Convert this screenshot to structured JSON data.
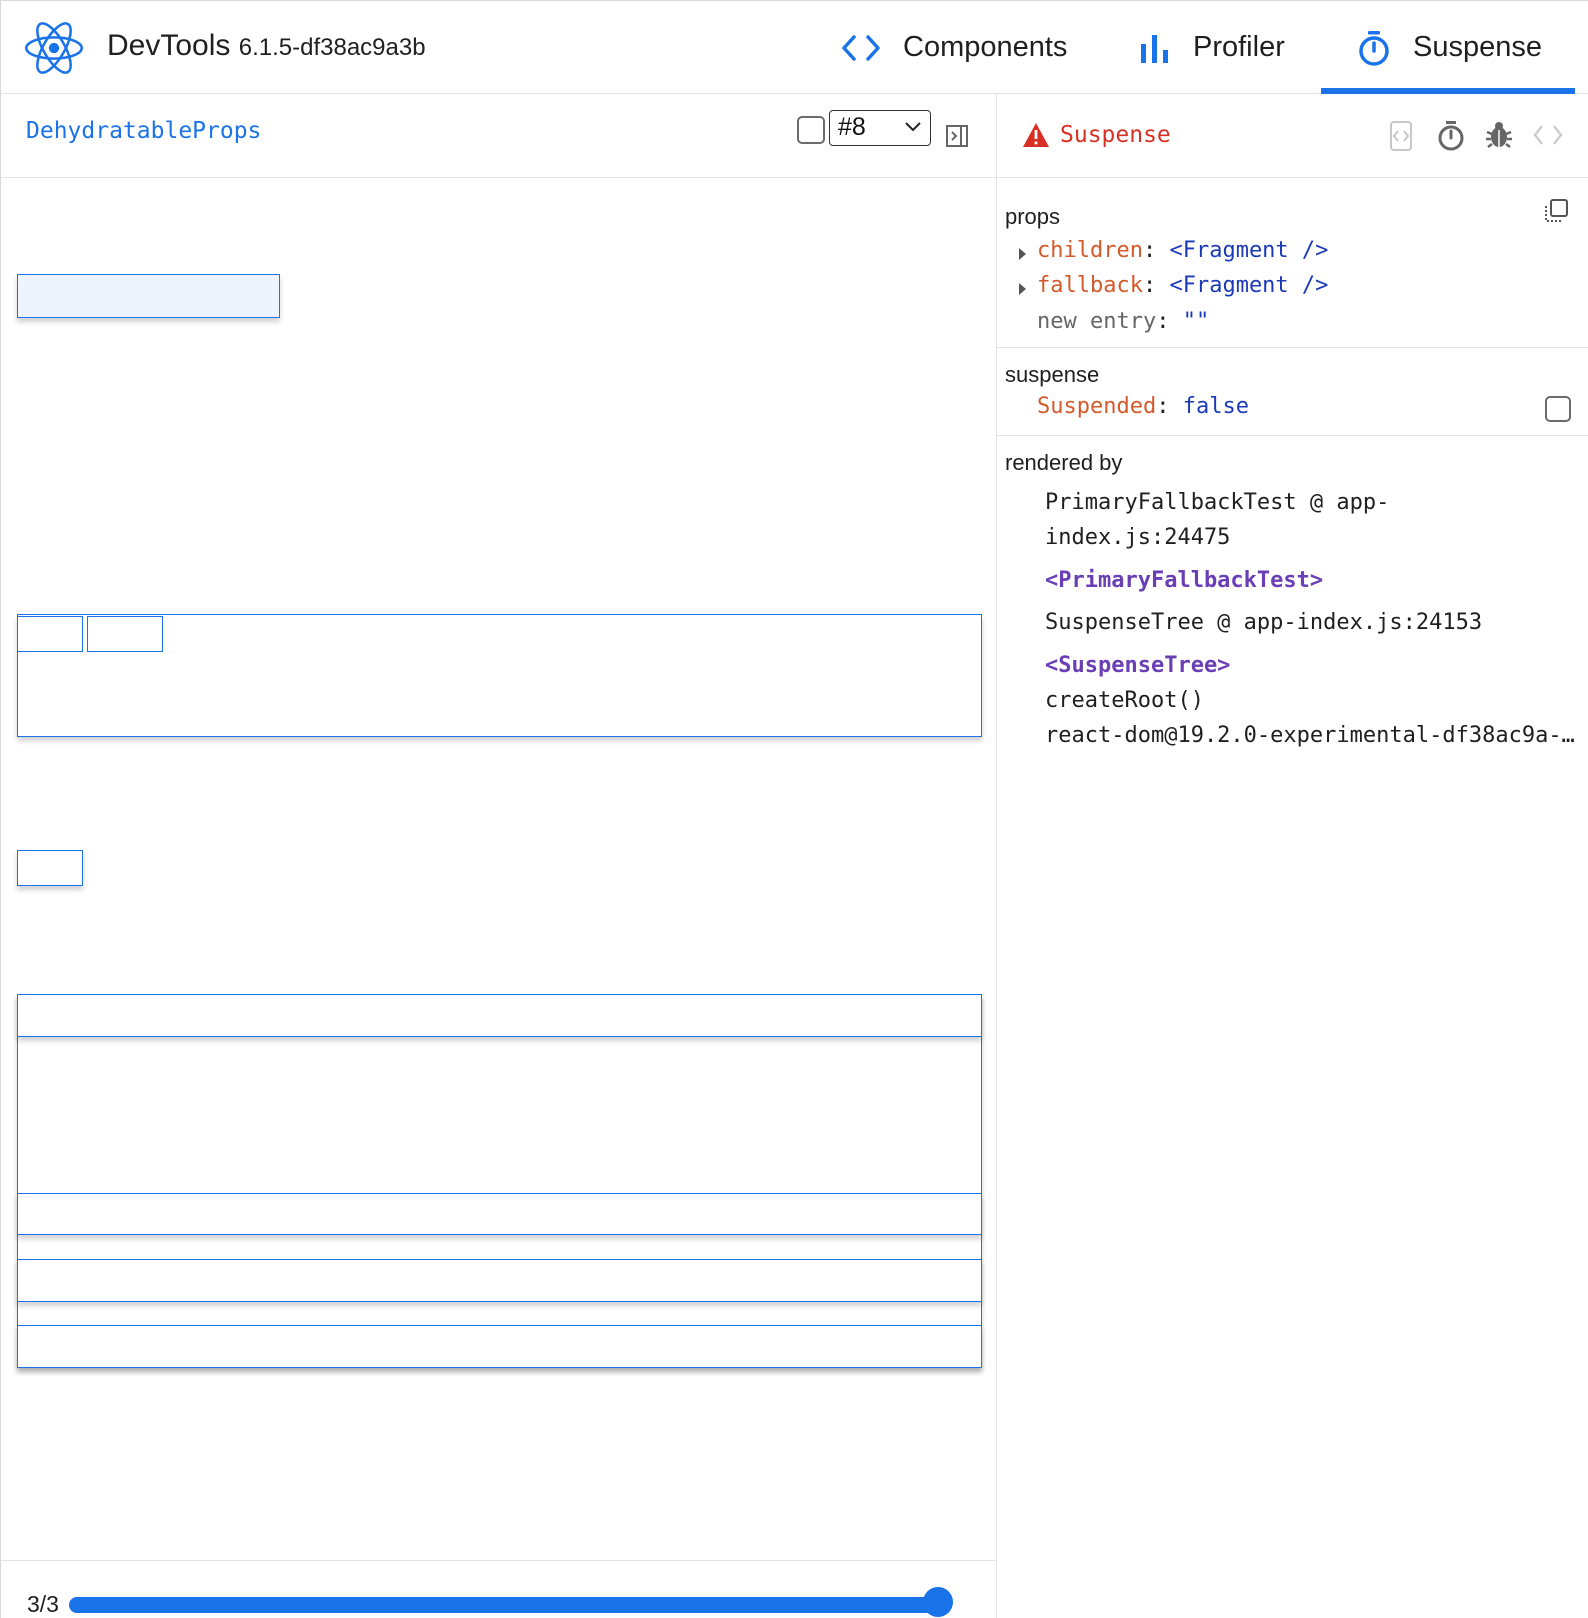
{
  "header": {
    "app_title": "DevTools",
    "app_version": "6.1.5-df38ac9a3b",
    "tabs": [
      {
        "label": "Components",
        "icon": "code-brackets-icon"
      },
      {
        "label": "Profiler",
        "icon": "bar-chart-icon"
      },
      {
        "label": "Suspense",
        "icon": "stopwatch-icon",
        "active": true
      }
    ],
    "accent_color": "#1a73e8"
  },
  "left_pane": {
    "breadcrumb": "DehydratableProps",
    "root_select": {
      "value": "#8"
    },
    "timeline": {
      "label": "3/3",
      "progress": 1.0
    }
  },
  "right_pane": {
    "selected_name": "Suspense",
    "selected_icon": "warning-icon",
    "toolbar_icons": [
      "inspect-dom-icon",
      "stopwatch-icon",
      "bug-icon",
      "source-code-icon"
    ],
    "props": {
      "title": "props",
      "entries": [
        {
          "key": "children",
          "value": "<Fragment />",
          "expandable": true
        },
        {
          "key": "fallback",
          "value": "<Fragment />",
          "expandable": true
        },
        {
          "key": "new entry",
          "value": "\"\"",
          "expandable": false
        }
      ]
    },
    "suspense": {
      "title": "suspense",
      "key": "Suspended",
      "value": "false"
    },
    "rendered_by": {
      "title": "rendered by",
      "items": [
        {
          "type": "source",
          "text": "PrimaryFallbackTest @ app-"
        },
        {
          "type": "source",
          "text": "index.js:24475"
        },
        {
          "type": "owner",
          "text": "<PrimaryFallbackTest>"
        },
        {
          "type": "source",
          "text": "SuspenseTree @ app-index.js:24153"
        },
        {
          "type": "owner",
          "text": "<SuspenseTree>"
        },
        {
          "type": "source",
          "text": "createRoot()"
        },
        {
          "type": "source",
          "text": "react-dom@19.2.0-experimental-df38ac9a-…"
        }
      ]
    },
    "value_colors": {
      "key": "#d35a2b",
      "value": "#1c3ab8",
      "owner": "#6a3fb5",
      "warning": "#d93025"
    }
  }
}
